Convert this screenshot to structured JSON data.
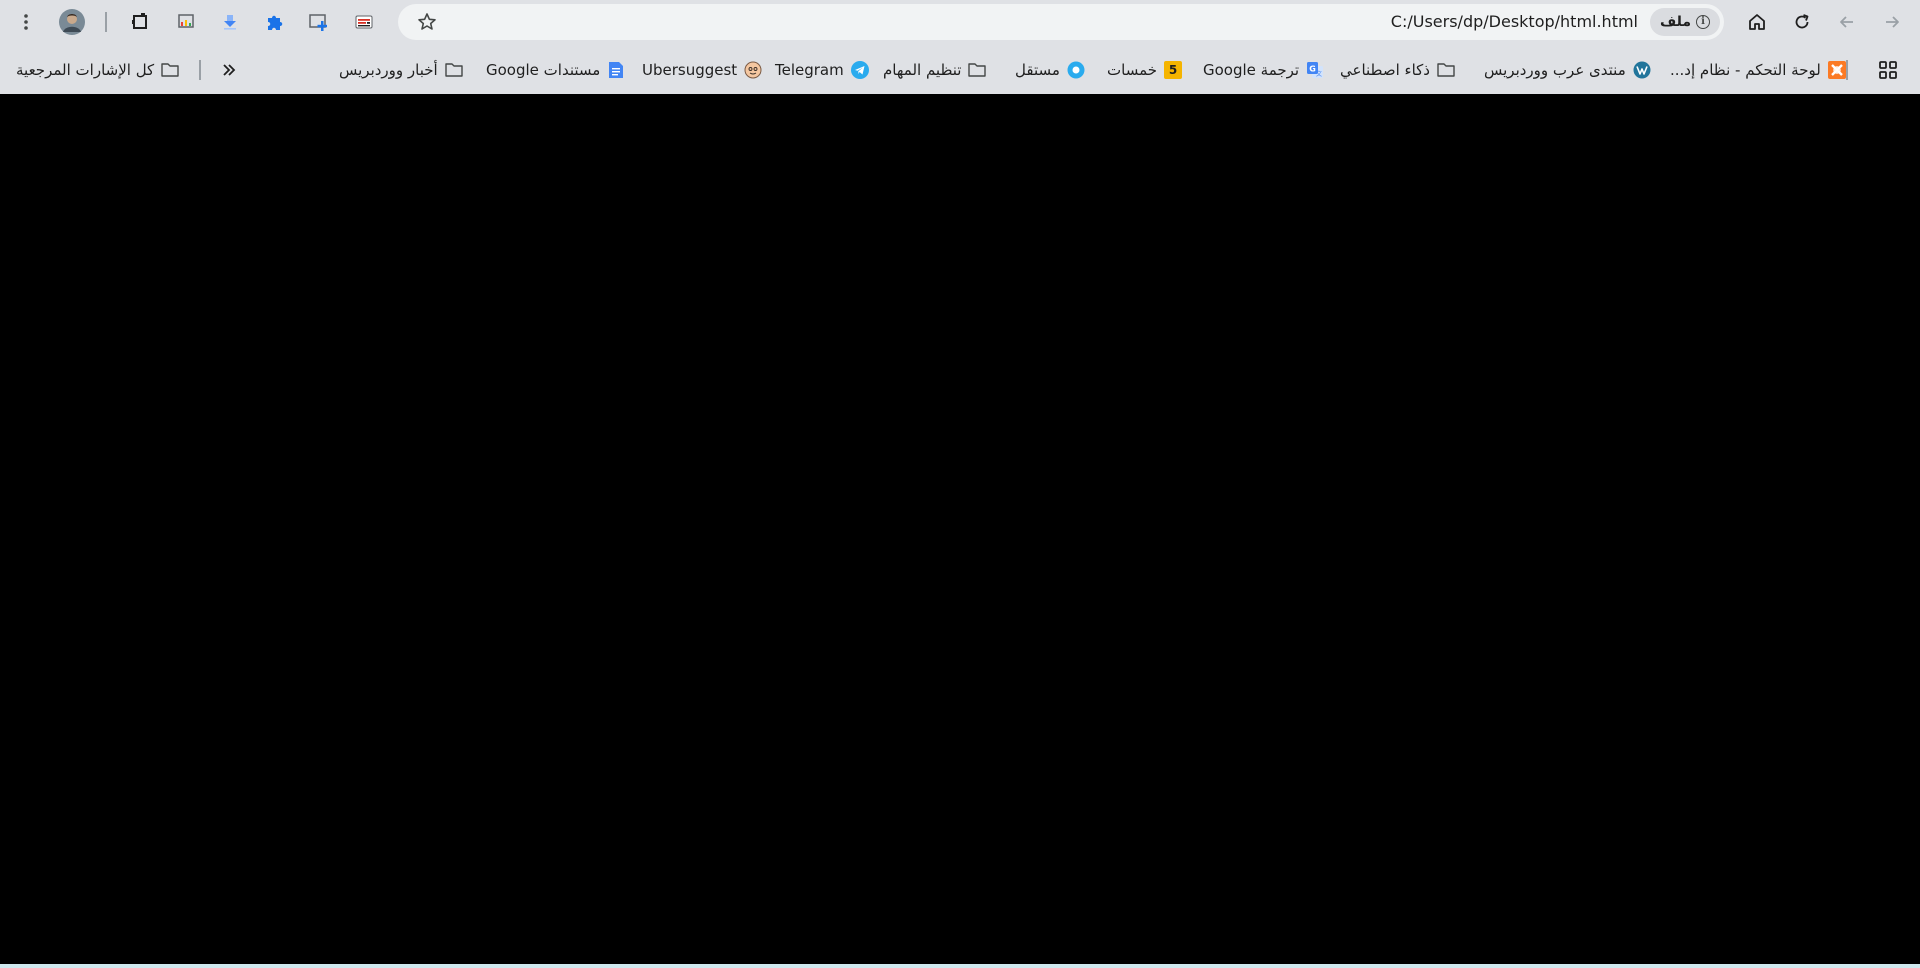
{
  "toolbar": {
    "url": "C:/Users/dp/Desktop/html.html",
    "site_chip_label": "ملف",
    "icons": {
      "forward": "arrow-right-icon",
      "back": "arrow-left-icon",
      "reload": "reload-icon",
      "home": "home-icon",
      "bookmark_star": "star-icon",
      "extensions": "puzzle-icon",
      "menu": "kebab-menu-icon"
    }
  },
  "bookmarks": {
    "items": [
      {
        "label": "لوحة التحكم - نظام إد...",
        "icon": "xampp-icon"
      },
      {
        "label": "منتدى عرب ووردبريس",
        "icon": "wordpress-icon"
      },
      {
        "label": "ذكاء اصطناعي",
        "icon": "folder-icon"
      },
      {
        "label": "ترجمة Google",
        "icon": "google-translate-icon"
      },
      {
        "label": "خمسات",
        "icon": "khamsat-icon",
        "badge": "5"
      },
      {
        "label": "مستقل",
        "icon": "mostaql-icon"
      },
      {
        "label": "تنظيم المهام",
        "icon": "folder-icon"
      },
      {
        "label": "Telegram",
        "icon": "telegram-icon"
      },
      {
        "label": "Ubersuggest",
        "icon": "ubersuggest-icon"
      },
      {
        "label": "مستندات Google",
        "icon": "google-docs-icon"
      },
      {
        "label": "أخبار ووردبريس",
        "icon": "folder-icon"
      }
    ],
    "all_bookmarks_label": "كل الإشارات المرجعية"
  },
  "colors": {
    "toolbar_bg": "#dfe1e5",
    "omnibox_bg": "#f1f3f4",
    "content_bg": "#000000",
    "extension_blue": "#1a73e8",
    "telegram_blue": "#2aabee",
    "khamsat_yellow": "#f5b400"
  }
}
